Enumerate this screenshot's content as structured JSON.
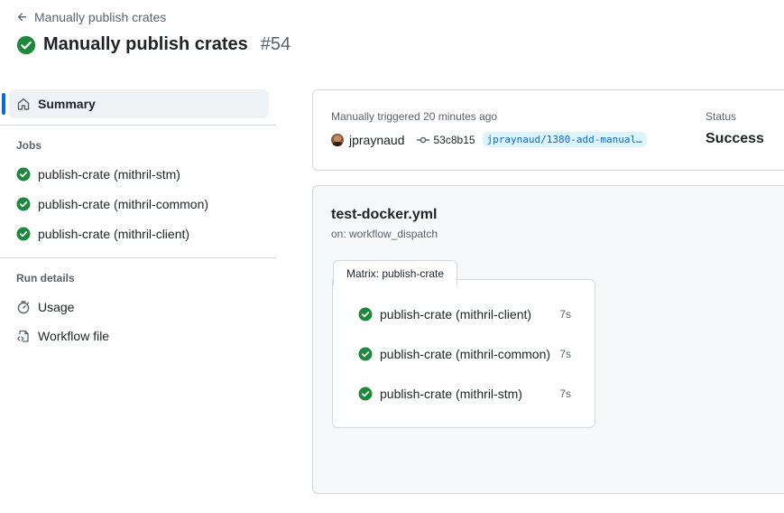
{
  "header": {
    "back_link": "Manually publish crates",
    "title": "Manually publish crates",
    "run_number": "#54"
  },
  "sidebar": {
    "summary": "Summary",
    "jobs_heading": "Jobs",
    "jobs": [
      {
        "label": "publish-crate (mithril-stm)",
        "status": "success"
      },
      {
        "label": "publish-crate (mithril-common)",
        "status": "success"
      },
      {
        "label": "publish-crate (mithril-client)",
        "status": "success"
      }
    ],
    "run_details_heading": "Run details",
    "usage": "Usage",
    "workflow_file": "Workflow file"
  },
  "trigger": {
    "label": "Manually triggered 20 minutes ago",
    "user": "jpraynaud",
    "commit": "53c8b15",
    "branch": "jpraynaud/1380-add-manual…",
    "status_label": "Status",
    "status_value": "Success"
  },
  "workflow": {
    "file": "test-docker.yml",
    "trigger": "on: workflow_dispatch",
    "matrix_label": "Matrix: publish-crate",
    "jobs": [
      {
        "name": "publish-crate (mithril-client)",
        "duration": "7s"
      },
      {
        "name": "publish-crate (mithril-common)",
        "duration": "7s"
      },
      {
        "name": "publish-crate (mithril-stm)",
        "duration": "7s"
      }
    ]
  },
  "colors": {
    "success": "#1f883d",
    "accent": "#0969da",
    "muted": "#59636e",
    "border": "#d1d9e0"
  },
  "icons": {
    "back": "arrow-left-icon",
    "success": "check-circle-fill-icon",
    "summary": "home-icon",
    "usage": "stopwatch-icon",
    "workflow_file": "file-code-icon",
    "commit": "git-commit-icon"
  }
}
